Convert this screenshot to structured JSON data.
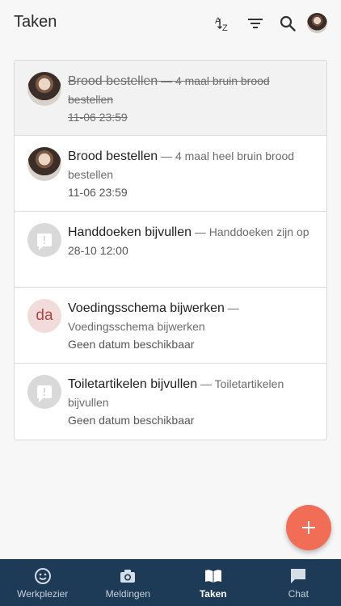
{
  "header": {
    "title": "Taken",
    "icons": [
      "sort-az-icon",
      "filter-icon",
      "search-icon",
      "profile-avatar"
    ]
  },
  "tasks": [
    {
      "name": "Brood bestellen",
      "separator": " — ",
      "description": "4 maal bruin brood bestellen",
      "date": "11-06 23:59",
      "completed": true,
      "avatar": "photo"
    },
    {
      "name": "Brood bestellen",
      "separator": " — ",
      "description": "4 maal heel bruin brood bestellen",
      "date": "11-06 23:59",
      "completed": false,
      "avatar": "photo"
    },
    {
      "name": "Handdoeken bijvullen",
      "separator": " — ",
      "description": "Handdoeken zijn op",
      "date": "28-10 12:00",
      "completed": false,
      "avatar": "chat-icon"
    },
    {
      "name": "Voedingsschema bijwerken",
      "separator": " — ",
      "description": "Voedingsschema bijwerken",
      "date": "Geen datum beschikbaar",
      "completed": false,
      "avatar": "initials",
      "initials": "da"
    },
    {
      "name": "Toiletartikelen bijvullen",
      "separator": " — ",
      "description": "Toiletartikelen bijvullen",
      "date": "Geen datum beschikbaar",
      "completed": false,
      "avatar": "chat-icon"
    }
  ],
  "fab": {
    "icon": "plus-icon"
  },
  "nav": [
    {
      "label": "Werkplezier",
      "icon": "smiley-icon",
      "active": false
    },
    {
      "label": "Meldingen",
      "icon": "camera-icon",
      "active": false
    },
    {
      "label": "Taken",
      "icon": "book-icon",
      "active": true
    },
    {
      "label": "Chat",
      "icon": "chat-icon",
      "active": false
    }
  ],
  "colors": {
    "accent": "#f26d55",
    "nav_background": "#1d3a57",
    "initials_bg": "#f1dcdb",
    "initials_text": "#b2453f"
  }
}
